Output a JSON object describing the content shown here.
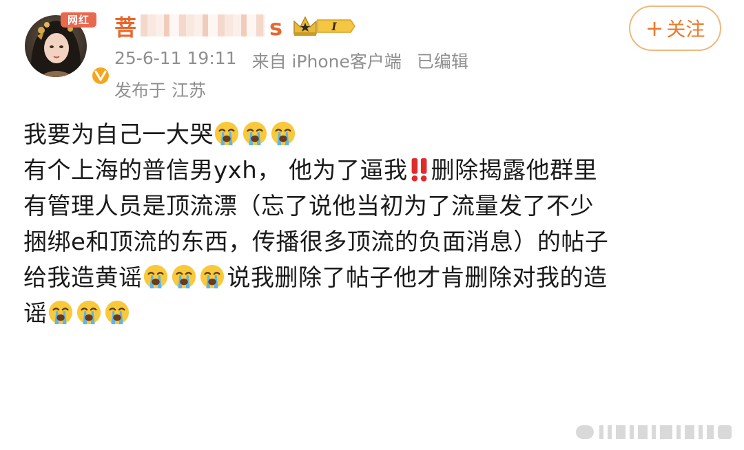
{
  "post": {
    "author": {
      "tag": "网红",
      "name_first_char": "菩",
      "name_last_char": "s",
      "level_badge": "I"
    },
    "follow_label": "关注",
    "meta": {
      "time": "25-6-11 19:11",
      "source": "来自 iPhone客户端",
      "edited": "已编辑",
      "location": "发布于 江苏"
    },
    "content": {
      "line1": "我要为自己一大哭",
      "line2a": "有个上海的普信男yxh，  他为了逼我",
      "line2b": "删除揭露他群里",
      "line3": "有管理人员是顶流漂（忘了说他当初为了流量发了不少",
      "line4": "捆绑e和顶流的东西，传播很多顶流的负面消息）的帖子",
      "line5a": "给我造黄谣",
      "line5b": "说我删除了帖子他才肯删除对我的造",
      "line6": "谣"
    },
    "icons": {
      "cry": "loudly-crying-face-icon",
      "bang": "double-exclamation-icon",
      "crown": "crown-icon",
      "verified": "verified-v-icon",
      "plus": "plus-icon"
    },
    "colors": {
      "username": "#e8672c",
      "follow_border": "#f0b87e",
      "meta_gray": "#8f8f8f",
      "tag_red": "#e9694f"
    }
  }
}
